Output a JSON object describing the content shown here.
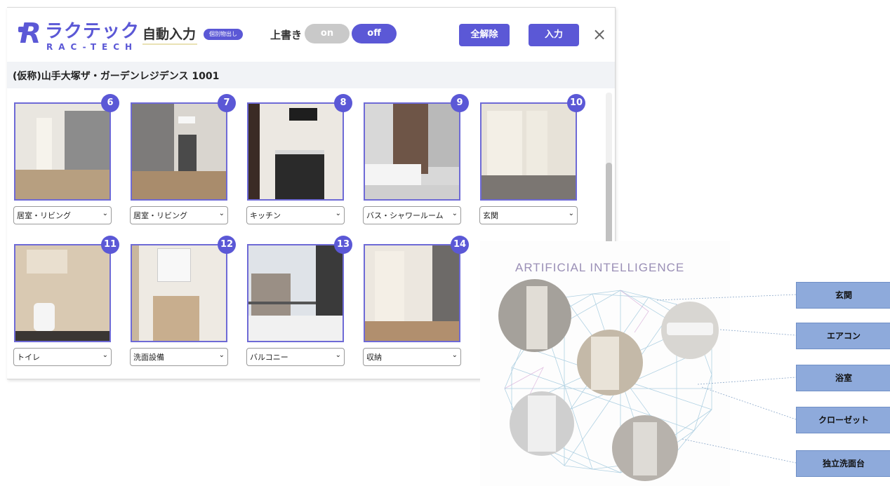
{
  "header": {
    "logo_symbol": "R",
    "logo_jp": "ラクテック",
    "logo_en": "RAC-TECH",
    "app_title": "自動入力",
    "mode_badge": "個別物出し",
    "overwrite_label": "上書き",
    "toggle_on": "on",
    "toggle_off": "off",
    "clear_all_label": "全解除",
    "input_label": "入力",
    "close_symbol": "×"
  },
  "property": {
    "name": "(仮称)山手大塚ザ・ガーデンレジデンス 1001"
  },
  "photos": [
    {
      "number": "6",
      "category": "居室・リビング"
    },
    {
      "number": "7",
      "category": "居室・リビング"
    },
    {
      "number": "8",
      "category": "キッチン"
    },
    {
      "number": "9",
      "category": "バス・シャワールーム"
    },
    {
      "number": "10",
      "category": "玄関"
    },
    {
      "number": "11",
      "category": "トイレ"
    },
    {
      "number": "12",
      "category": "洗面設備"
    },
    {
      "number": "13",
      "category": "バルコニー"
    },
    {
      "number": "14",
      "category": "収納"
    }
  ],
  "ai_diagram": {
    "title": "ARTIFICIAL INTELLIGENCE",
    "labels": [
      "玄関",
      "エアコン",
      "浴室",
      "クローゼット",
      "独立洗面台"
    ]
  },
  "colors": {
    "accent": "#5b58d6",
    "toggle_inactive": "#c9c9c9",
    "label_box": "#8eaadb"
  }
}
